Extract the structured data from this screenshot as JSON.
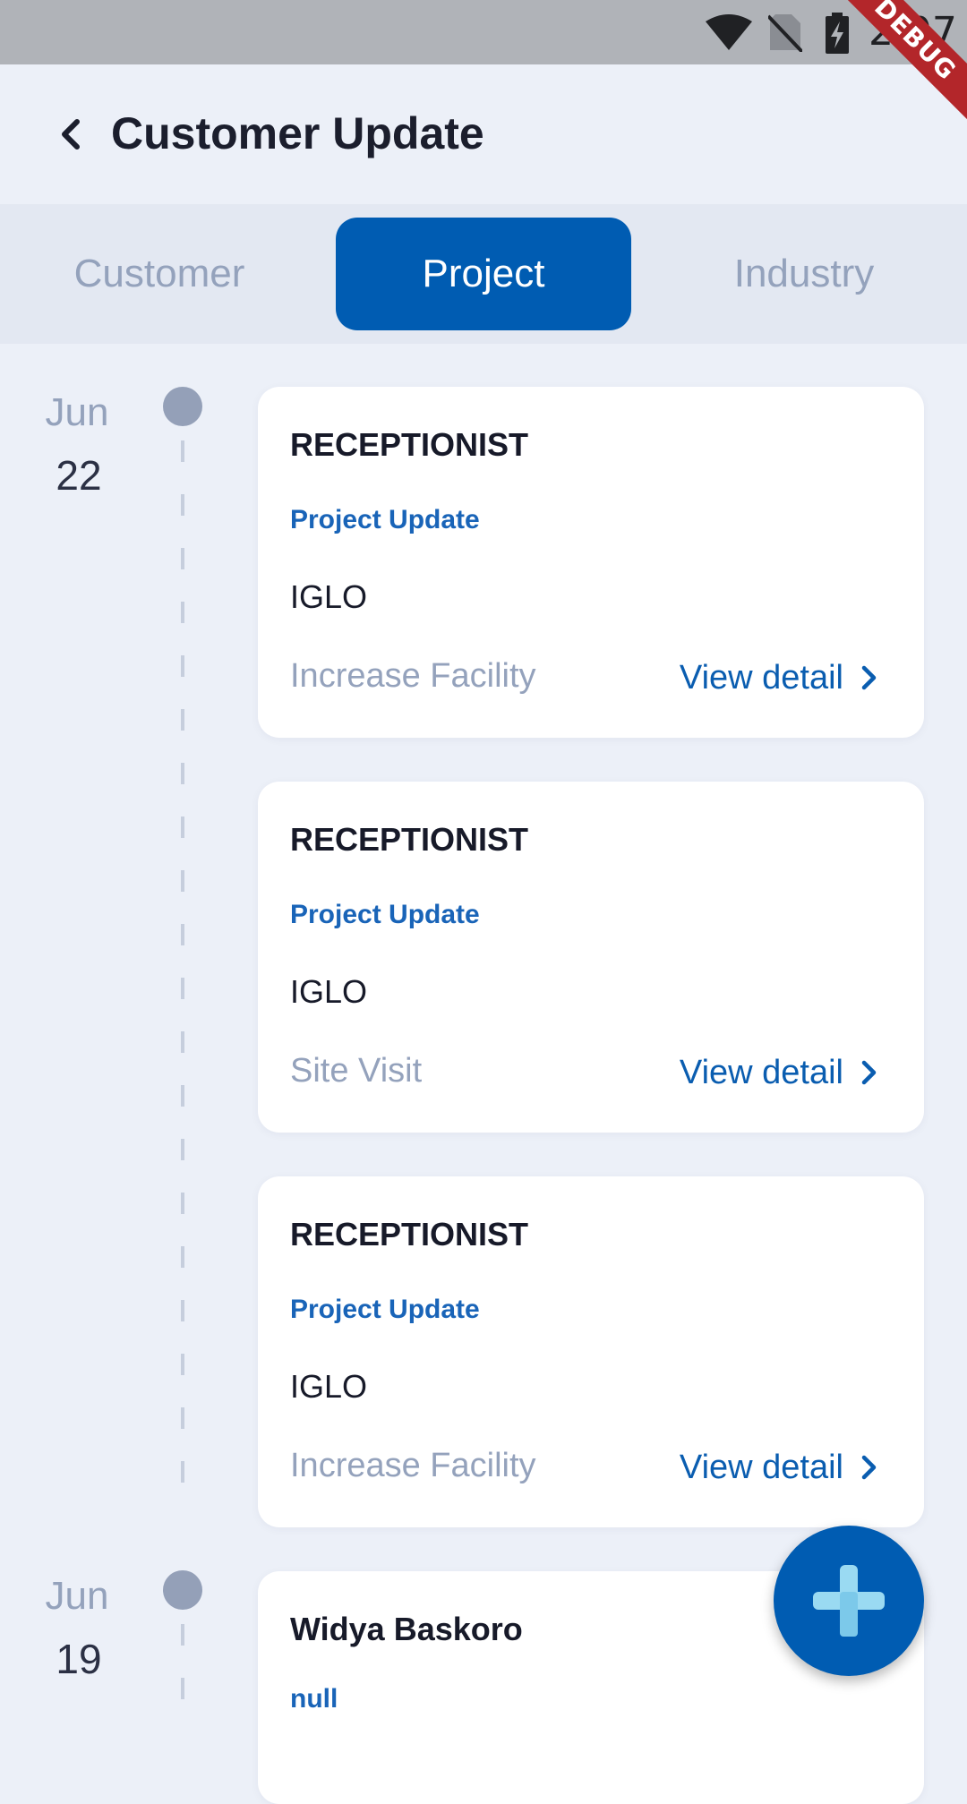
{
  "status_bar": {
    "time": "2:07",
    "icons": [
      "wifi-icon",
      "no-sim-icon",
      "battery-charging-icon"
    ],
    "debug_label": "DEBUG"
  },
  "header": {
    "title": "Customer Update",
    "back_icon": "chevron-left-icon"
  },
  "tabs": [
    {
      "label": "Customer",
      "active": false
    },
    {
      "label": "Project",
      "active": true
    },
    {
      "label": "Industry",
      "active": false
    }
  ],
  "groups": [
    {
      "month": "Jun",
      "day": "22",
      "items": [
        {
          "title": "RECEPTIONIST",
          "type": "Project Update",
          "company": "IGLO",
          "activity": "Increase Facility",
          "action": "View detail"
        },
        {
          "title": "RECEPTIONIST",
          "type": "Project Update",
          "company": "IGLO",
          "activity": "Site Visit",
          "action": "View detail"
        },
        {
          "title": "RECEPTIONIST",
          "type": "Project Update",
          "company": "IGLO",
          "activity": "Increase Facility",
          "action": "View detail"
        }
      ]
    },
    {
      "month": "Jun",
      "day": "19",
      "items": [
        {
          "title": "Widya Baskoro",
          "type": "null"
        }
      ]
    }
  ],
  "fab": {
    "icon": "plus-icon"
  },
  "colors": {
    "primary": "#005CB2",
    "background": "#ECF0F8",
    "muted_text": "#94A2BC",
    "card": "#FFFFFF"
  }
}
